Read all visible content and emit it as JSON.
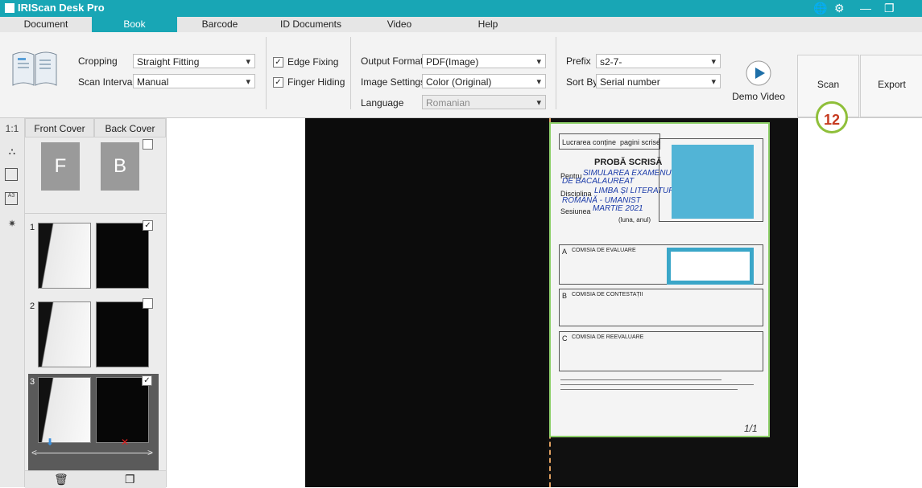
{
  "app": {
    "title": "IRIScan Desk Pro"
  },
  "menu": {
    "tabs": [
      "Document",
      "Book",
      "Barcode",
      "ID Documents",
      "Video",
      "Help"
    ],
    "active": "Book"
  },
  "toolbar": {
    "cropping_label": "Cropping",
    "cropping_value": "Straight Fitting",
    "scan_interval_label": "Scan Interval",
    "scan_interval_value": "Manual",
    "edge_fixing": "Edge Fixing",
    "finger_hiding": "Finger Hiding",
    "output_format_label": "Output Format",
    "output_format_value": "PDF(Image)",
    "image_settings_label": "Image Settings",
    "image_settings_value": "Color (Original)",
    "language_label": "Language",
    "language_value": "Romanian",
    "prefix_label": "Prefix",
    "prefix_value": "s2-7-",
    "sort_by_label": "Sort By",
    "sort_by_value": "Serial number",
    "demo_video": "Demo Video",
    "scan": "Scan",
    "export": "Export"
  },
  "left_tools": {
    "ratio": "1:1"
  },
  "thumbs": {
    "front_cover": "Front Cover",
    "back_cover": "Back Cover",
    "cover_front_letter": "F",
    "cover_back_letter": "B",
    "rows": [
      "1",
      "2",
      "3"
    ]
  },
  "badge": {
    "number": "12"
  },
  "document": {
    "header1": "Lucrarea conține",
    "header1b": "pagini scrise",
    "title": "PROBĂ SCRISĂ",
    "row1_label": "Pentru",
    "row1_value": "SIMULAREA EXAMENULUI",
    "row1b_value": "DE BACALAUREAT",
    "row2_label": "Disciplina",
    "row2_value": "LIMBA ȘI LITERATURA",
    "row2b_value": "ROMÂNĂ - UMANIST",
    "row3_label": "Sesiunea",
    "row3_value": "MARTIE 2021",
    "row3b_value": "(luna, anul)",
    "section_a": "A",
    "section_b": "B",
    "section_c": "C",
    "comisia_a": "COMISIA DE EVALUARE",
    "comisia_b": "COMISIA DE CONTESTAȚII",
    "comisia_c": "COMISIA DE REEVALUARE",
    "footer_page": "1/1"
  }
}
